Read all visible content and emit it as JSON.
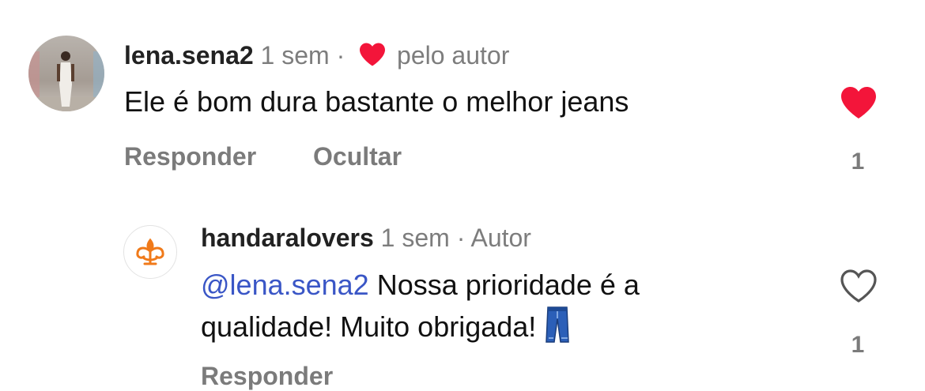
{
  "comment": {
    "username": "lena.sena2",
    "time": "1 sem",
    "separator": "·",
    "liked_by_author": "pelo autor",
    "text": "Ele é bom dura bastante o melhor jeans",
    "reply_label": "Responder",
    "hide_label": "Ocultar",
    "like_count": "1",
    "liked": true
  },
  "reply": {
    "username": "handaralovers",
    "time": "1 sem",
    "separator": "·",
    "role": "Autor",
    "mention": "@lena.sena2",
    "text_line1": " Nossa prioridade é a",
    "text_line2": "qualidade! Muito obrigada! ",
    "emoji": "jeans-emoji",
    "reply_label": "Responder",
    "like_count": "1",
    "liked": false
  },
  "colors": {
    "like_red": "#f3153a",
    "mention_blue": "#3a56c6",
    "brand_orange": "#f07a1a"
  }
}
